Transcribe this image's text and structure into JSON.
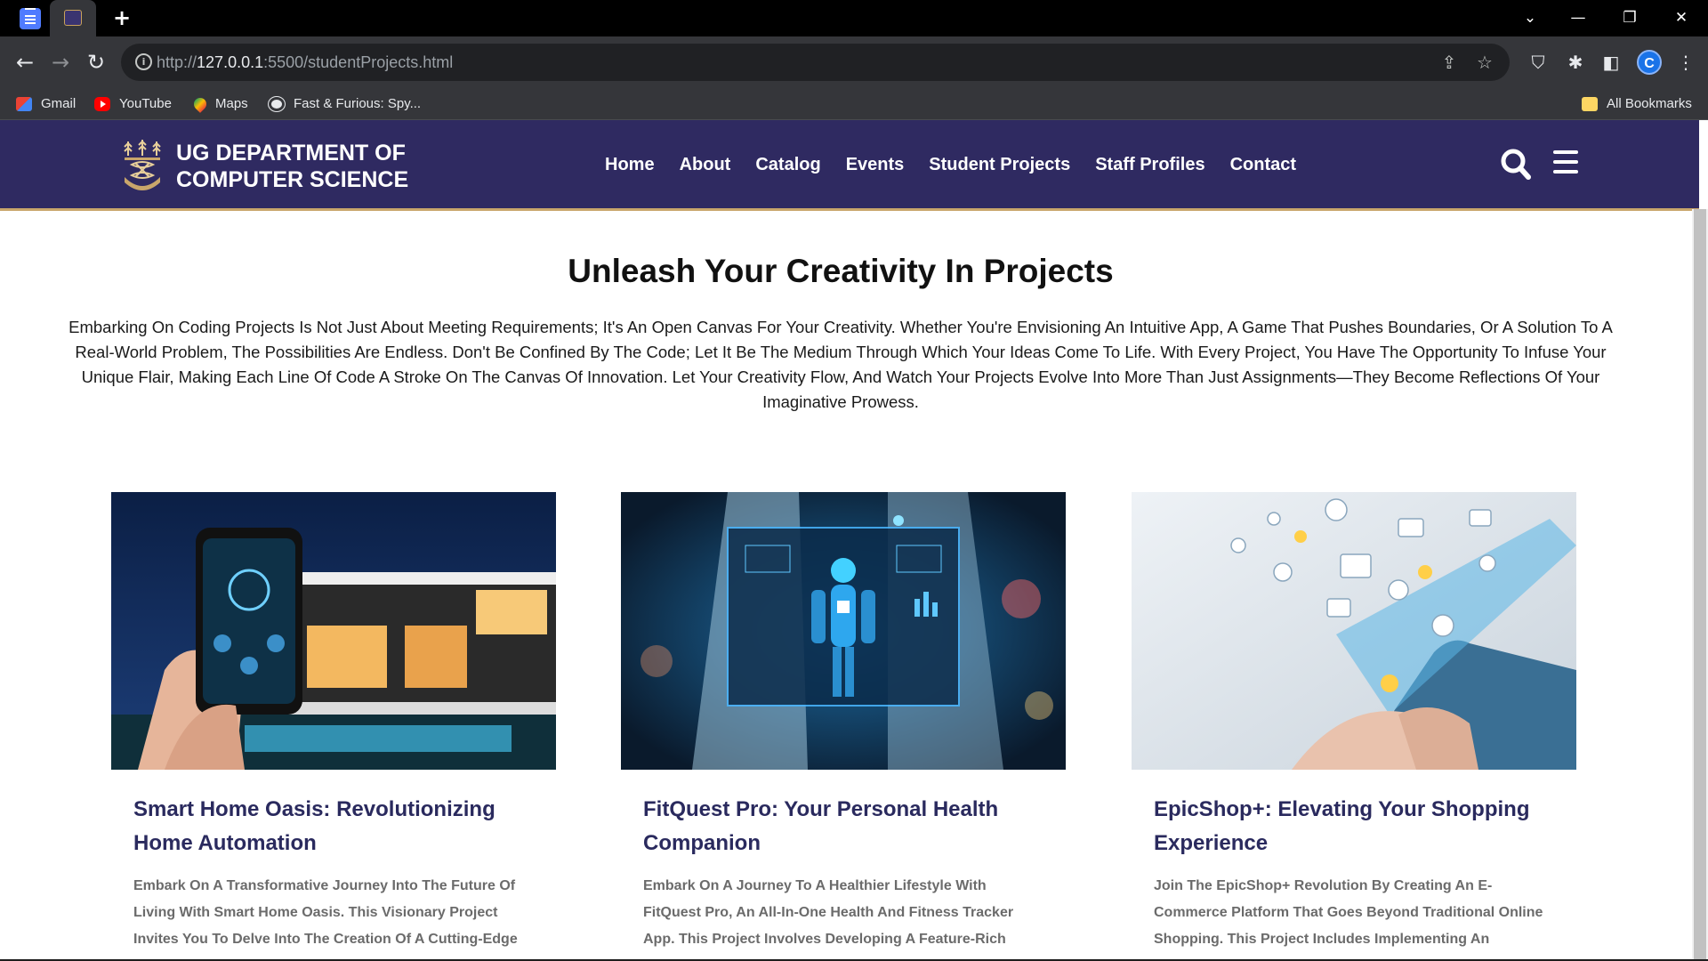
{
  "browser": {
    "url_scheme": "http://",
    "url_host": "127.0.0.1",
    "url_path": ":5500/studentProjects.html",
    "profile_initial": "C",
    "bookmarks": [
      {
        "label": "Gmail",
        "icon": "gmail-icon"
      },
      {
        "label": "YouTube",
        "icon": "youtube-icon"
      },
      {
        "label": "Maps",
        "icon": "maps-icon"
      },
      {
        "label": "Fast & Furious: Spy...",
        "icon": "globe-icon"
      }
    ],
    "all_bookmarks_label": "All Bookmarks"
  },
  "header": {
    "brand_line1": "UG DEPARTMENT OF",
    "brand_line2": "COMPUTER SCIENCE",
    "nav": [
      "Home",
      "About",
      "Catalog",
      "Events",
      "Student Projects",
      "Staff Profiles",
      "Contact"
    ],
    "colors": {
      "background": "#2f2a61",
      "accent": "#c9a66b"
    }
  },
  "hero": {
    "title": "Unleash Your Creativity In Projects",
    "text": "Embarking On Coding Projects Is Not Just About Meeting Requirements; It's An Open Canvas For Your Creativity. Whether You're Envisioning An Intuitive App, A Game That Pushes Boundaries, Or A Solution To A Real-World Problem, The Possibilities Are Endless. Don't Be Confined By The Code; Let It Be The Medium Through Which Your Ideas Come To Life. With Every Project, You Have The Opportunity To Infuse Your Unique Flair, Making Each Line Of Code A Stroke On The Canvas Of Innovation. Let Your Creativity Flow, And Watch Your Projects Evolve Into More Than Just Assignments—They Become Reflections Of Your Imaginative Prowess."
  },
  "projects": [
    {
      "title": "Smart Home Oasis: Revolutionizing Home Automation",
      "description": "Embark On A Transformative Journey Into The Future Of Living With Smart Home Oasis. This Visionary Project Invites You To Delve Into The Creation Of A Cutting-Edge"
    },
    {
      "title": "FitQuest Pro: Your Personal Health Companion",
      "description": "Embark On A Journey To A Healthier Lifestyle With FitQuest Pro, An All-In-One Health And Fitness Tracker App. This Project Involves Developing A Feature-Rich"
    },
    {
      "title": "EpicShop+: Elevating Your Shopping Experience",
      "description": "Join The EpicShop+ Revolution By Creating An E-Commerce Platform That Goes Beyond Traditional Online Shopping. This Project Includes Implementing An"
    }
  ]
}
